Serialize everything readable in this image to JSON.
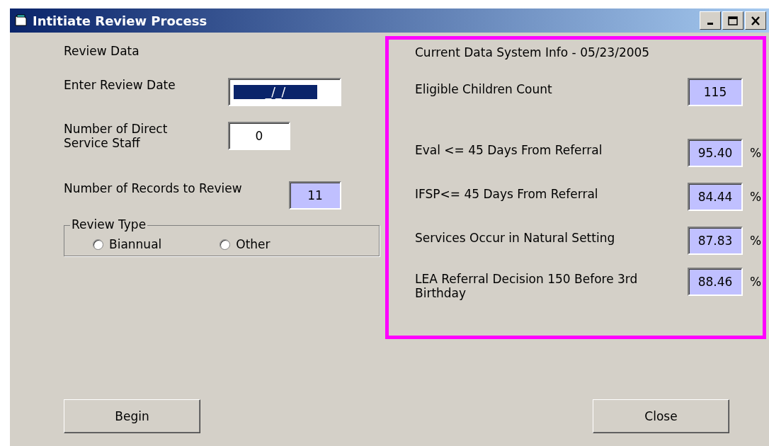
{
  "window": {
    "title": "Intitiate Review Process"
  },
  "review": {
    "heading": "Review Data",
    "fields": [
      {
        "label": "Enter Review Date",
        "value": "_/_/",
        "selected": true,
        "readonly": false
      },
      {
        "label": "Number of Direct Service Staff",
        "value": "0",
        "selected": false,
        "readonly": false
      },
      {
        "label": "Number of Records to Review",
        "value": "11",
        "selected": false,
        "readonly": true
      }
    ],
    "review_type": {
      "label": "Review Type",
      "options": [
        {
          "label": "Biannual",
          "selected": false
        },
        {
          "label": "Other",
          "selected": false
        }
      ]
    }
  },
  "current_info": {
    "heading": "Current Data System Info - 05/23/2005",
    "rows": [
      {
        "label": "Eligible Children Count",
        "value": "115"
      },
      {
        "label": "Eval <= 45 Days From Referral",
        "value": "95.40",
        "unit": "%"
      },
      {
        "label": "IFSP<= 45 Days From Referral",
        "value": "84.44",
        "unit": "%"
      },
      {
        "label": "Services Occur in Natural Setting",
        "value": "87.83",
        "unit": "%"
      },
      {
        "label": "LEA Referral Decision 150 Before 3rd Birthday",
        "value": "88.46",
        "unit": "%"
      }
    ]
  },
  "buttons": [
    "Begin",
    "Close"
  ]
}
